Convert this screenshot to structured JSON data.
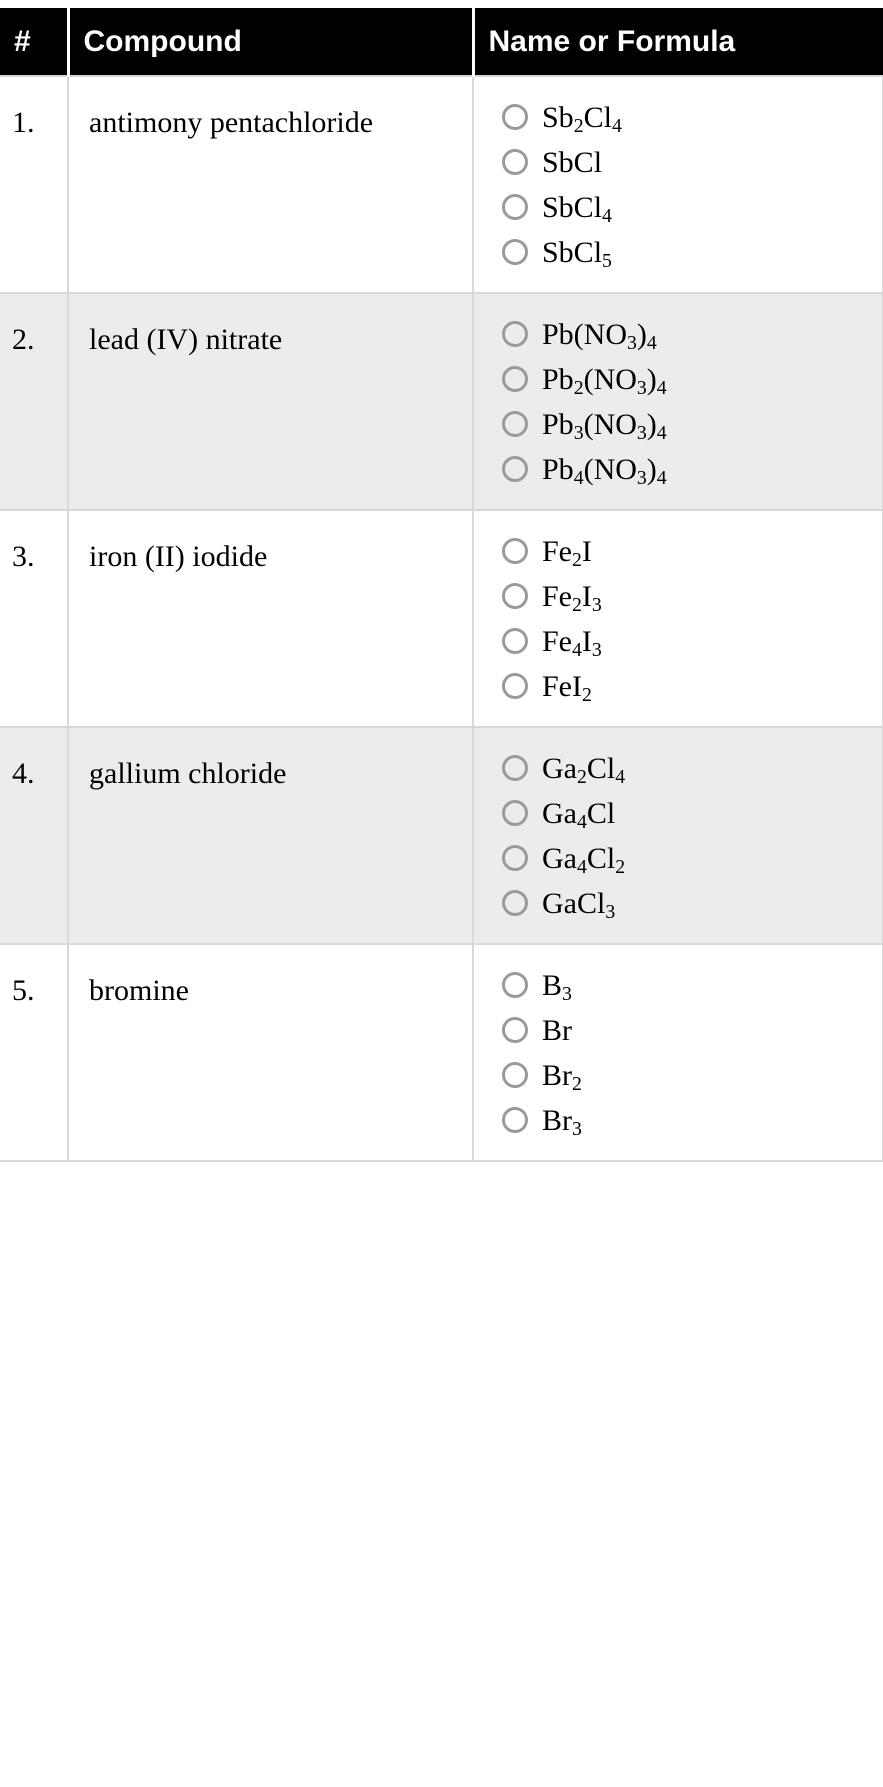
{
  "table": {
    "headers": {
      "number": "#",
      "compound": "Compound",
      "answer": "Name or Formula"
    },
    "rows": [
      {
        "number": "1.",
        "compound": "antimony pentachloride",
        "options": [
          {
            "text": "Sb2Cl4",
            "base1": "Sb",
            "sub1": "2",
            "base2": "Cl",
            "sub2": "4"
          },
          {
            "text": "SbCl",
            "base1": "SbCl",
            "sub1": "",
            "base2": "",
            "sub2": ""
          },
          {
            "text": "SbCl4",
            "base1": "SbCl",
            "sub1": "4",
            "base2": "",
            "sub2": ""
          },
          {
            "text": "SbCl5",
            "base1": "SbCl",
            "sub1": "5",
            "base2": "",
            "sub2": ""
          }
        ]
      },
      {
        "number": "2.",
        "compound": "lead (IV) nitrate",
        "options": [
          {
            "text": "Pb(NO3)4",
            "base1": "Pb(NO",
            "sub1": "3",
            "base2": ")",
            "sub2": "4"
          },
          {
            "text": "Pb2(NO3)4",
            "base1": "Pb",
            "sub1": "2",
            "base2": "(NO",
            "sub2": "3",
            "base3": ")",
            "sub3": "4"
          },
          {
            "text": "Pb3(NO3)4",
            "base1": "Pb",
            "sub1": "3",
            "base2": "(NO",
            "sub2": "3",
            "base3": ")",
            "sub3": "4"
          },
          {
            "text": "Pb4(NO3)4",
            "base1": "Pb",
            "sub1": "4",
            "base2": "(NO",
            "sub2": "3",
            "base3": ")",
            "sub3": "4"
          }
        ]
      },
      {
        "number": "3.",
        "compound": "iron (II) iodide",
        "options": [
          {
            "text": "Fe2I",
            "base1": "Fe",
            "sub1": "2",
            "base2": "I",
            "sub2": ""
          },
          {
            "text": "Fe2I3",
            "base1": "Fe",
            "sub1": "2",
            "base2": "I",
            "sub2": "3"
          },
          {
            "text": "Fe4I3",
            "base1": "Fe",
            "sub1": "4",
            "base2": "I",
            "sub2": "3"
          },
          {
            "text": "FeI2",
            "base1": "FeI",
            "sub1": "2",
            "base2": "",
            "sub2": ""
          }
        ]
      },
      {
        "number": "4.",
        "compound": "gallium chloride",
        "options": [
          {
            "text": "Ga2Cl4",
            "base1": "Ga",
            "sub1": "2",
            "base2": "Cl",
            "sub2": "4"
          },
          {
            "text": "Ga4Cl",
            "base1": "Ga",
            "sub1": "4",
            "base2": "Cl",
            "sub2": ""
          },
          {
            "text": "Ga4Cl2",
            "base1": "Ga",
            "sub1": "4",
            "base2": "Cl",
            "sub2": "2"
          },
          {
            "text": "GaCl3",
            "base1": "GaCl",
            "sub1": "3",
            "base2": "",
            "sub2": ""
          }
        ]
      },
      {
        "number": "5.",
        "compound": "bromine",
        "options": [
          {
            "text": "B3",
            "base1": "B",
            "sub1": "3",
            "base2": "",
            "sub2": ""
          },
          {
            "text": "Br",
            "base1": "Br",
            "sub1": "",
            "base2": "",
            "sub2": ""
          },
          {
            "text": "Br2",
            "base1": "Br",
            "sub1": "2",
            "base2": "",
            "sub2": ""
          },
          {
            "text": "Br3",
            "base1": "Br",
            "sub1": "3",
            "base2": "",
            "sub2": ""
          }
        ]
      }
    ]
  },
  "icons": {
    "radio": "radio-unselected-icon"
  },
  "colors": {
    "header_background": "#000000",
    "header_text": "#ffffff",
    "row_odd_background": "#ffffff",
    "row_even_background": "#ececec",
    "border": "#d8d8d8",
    "radio_border": "#9a9a9a",
    "text": "#000000"
  }
}
